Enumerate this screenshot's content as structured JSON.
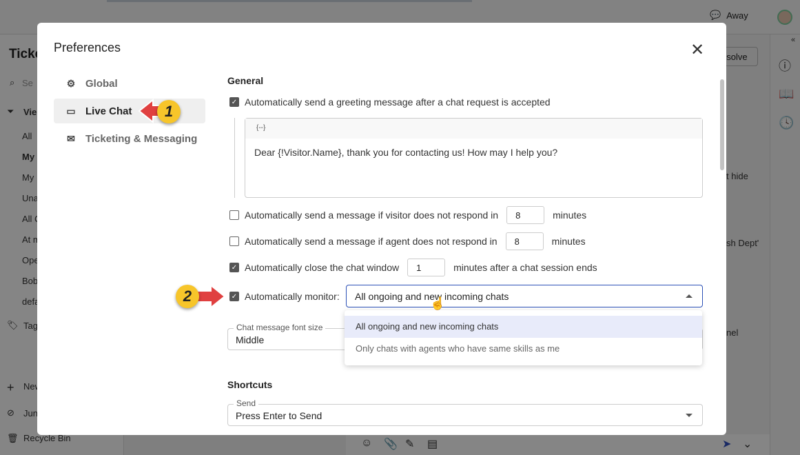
{
  "background": {
    "status": "Away",
    "left_title": "Ticke",
    "search_placeholder": "Se",
    "views_label": "Vie",
    "view_items": [
      "All",
      "My",
      "My",
      "Una",
      "All C",
      "At m",
      "Ope",
      "Bob",
      "defa"
    ],
    "tags_label": "Tag",
    "new_label": "New",
    "junk_label": "Jun",
    "recycle_label": "Recycle Bin",
    "resolve_label": "esolve",
    "snippet_1": "t hide",
    "snippet_2": "sh Dept'",
    "snippet_3": "nel"
  },
  "modal": {
    "title": "Preferences",
    "nav": [
      {
        "label": "Global",
        "icon": "sliders-icon"
      },
      {
        "label": "Live Chat",
        "icon": "chat-icon",
        "active": true
      },
      {
        "label": "Ticketing & Messaging",
        "icon": "messaging-icon"
      }
    ],
    "general": {
      "heading": "General",
      "greeting_checkbox": {
        "label": "Automatically send a greeting message after a chat request is accepted",
        "checked": true
      },
      "greeting_toolbar": "{--}",
      "greeting_text": "Dear {!Visitor.Name}, thank you for contacting us! How may I help you?",
      "visitor_noresponse": {
        "label": "Automatically send a message if visitor does not respond in",
        "value": "8",
        "unit": "minutes",
        "checked": false
      },
      "agent_noresponse": {
        "label": "Automatically send a message if agent does not respond in",
        "value": "8",
        "unit": "minutes",
        "checked": false
      },
      "autoclose": {
        "label": "Automatically close the chat window",
        "value": "1",
        "unit": "minutes after a chat session ends",
        "checked": true
      },
      "monitor": {
        "label": "Automatically monitor:",
        "value": "All ongoing and new incoming chats",
        "checked": true,
        "options": [
          "All ongoing and new incoming chats",
          "Only chats with agents who have same skills as me"
        ]
      },
      "font_size": {
        "label": "Chat message font size",
        "value": "Middle"
      }
    },
    "shortcuts": {
      "heading": "Shortcuts",
      "send": {
        "label": "Send",
        "value": "Press Enter to Send"
      }
    }
  },
  "annotations": [
    "1",
    "2"
  ],
  "colors": {
    "accent": "#2a4fb6",
    "arrow": "#e04040",
    "badge": "#f7c52a"
  }
}
